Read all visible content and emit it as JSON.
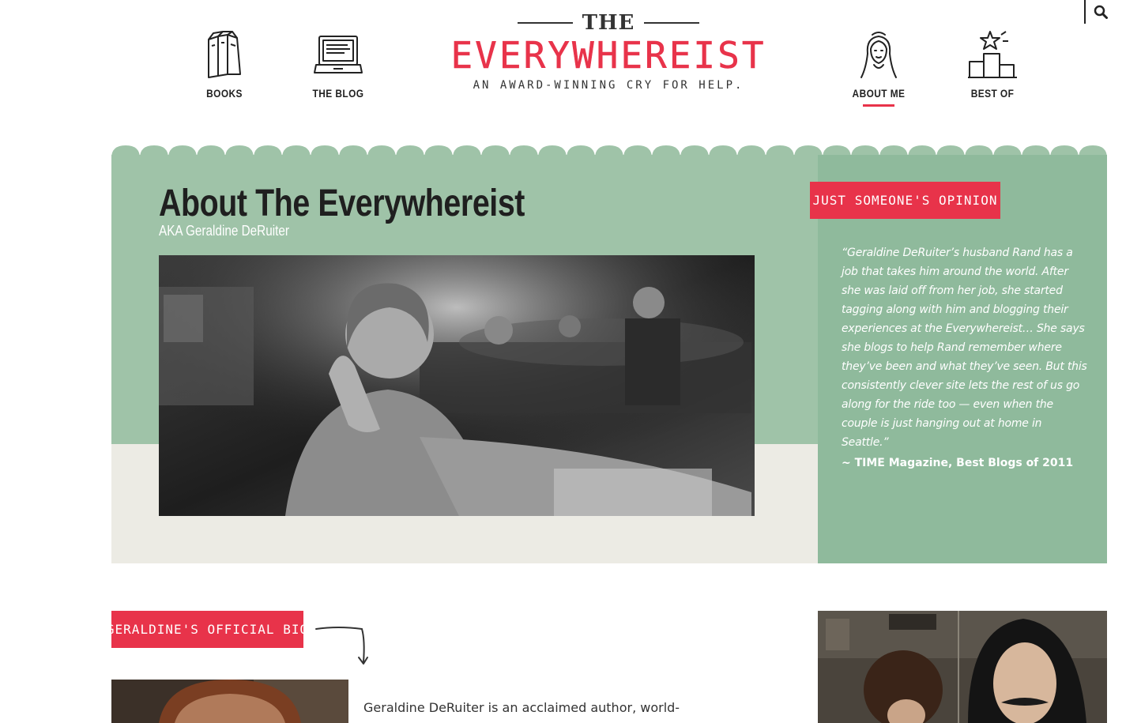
{
  "search": {
    "icon": "search-icon"
  },
  "nav": {
    "left": [
      {
        "label": "BOOKS",
        "icon": "books-icon"
      },
      {
        "label": "THE BLOG",
        "icon": "laptop-icon"
      }
    ],
    "right": [
      {
        "label": "ABOUT ME",
        "icon": "woman-portrait-icon",
        "active": true
      },
      {
        "label": "BEST OF",
        "icon": "podium-star-icon"
      }
    ]
  },
  "logo": {
    "the": "THE",
    "name": "EVERYWHEREIST",
    "tagline": "AN AWARD-WINNING CRY FOR HELP."
  },
  "hero": {
    "title": "About The Everywhereist",
    "subtitle": "AKA Geraldine DeRuiter",
    "photo_alt": "black-and-white photo of Geraldine DeRuiter in a restaurant"
  },
  "quote": {
    "tag": "JUST SOMEONE'S OPINION",
    "text": "“Geraldine DeRuiter’s husband Rand has a job that takes him around the world. After she was laid off from her job, she started tagging along with him and blogging their experiences at the Everywhereist… She says she blogs to help Rand remember where they’ve been and what they’ve seen. But this consistently clever site lets the rest of us go along for the ride too — even when the couple is just hanging out at home in Seattle.”",
    "source": "~ TIME Magazine, Best Blogs of 2011"
  },
  "bio": {
    "tag": "GERALDINE'S OFFICIAL BIO",
    "text": "Geraldine DeRuiter is an acclaimed author, world-"
  },
  "colors": {
    "accent": "#e8334a",
    "green": "#9fc3a8",
    "green_dark": "#8fba9c",
    "cream": "#ecebe4"
  }
}
